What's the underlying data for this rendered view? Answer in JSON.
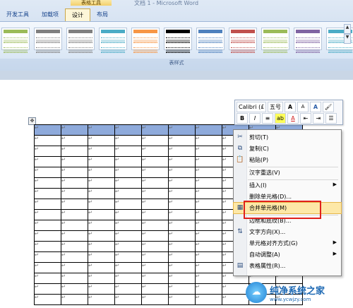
{
  "window": {
    "contextual_tab_group": "表格工具",
    "doc_title": "文档 1 - Microsoft Word"
  },
  "tabs": [
    {
      "label": "开发工具",
      "active": false
    },
    {
      "label": "加载项",
      "active": false
    },
    {
      "label": "设计",
      "active": true
    },
    {
      "label": "布局",
      "active": false
    }
  ],
  "ribbon": {
    "group_label": "表样式",
    "swatch_colors": [
      "#9bbb59",
      "#7f7f7f",
      "#7f7f7f",
      "#4bacc6",
      "#f79646",
      "#000000",
      "#4f81bd",
      "#c0504d",
      "#9bbb59",
      "#8064a2",
      "#4bacc6"
    ]
  },
  "mini_toolbar": {
    "font_name": "Calibri (£",
    "font_size": "五号",
    "grow_font": "A",
    "shrink_font": "A",
    "style_a": "A",
    "bold": "B",
    "italic": "I",
    "highlight": "ab",
    "font_color": "A"
  },
  "table": {
    "handle_icon": "move-icon",
    "columns": 10,
    "rows": 17,
    "cell_mark": "↵"
  },
  "context_menu": {
    "items": [
      {
        "label": "剪切(T)",
        "icon": "scissors-icon",
        "submenu": false
      },
      {
        "label": "复制(C)",
        "icon": "copy-icon",
        "submenu": false
      },
      {
        "label": "粘贴(P)",
        "icon": "paste-icon",
        "submenu": false
      },
      {
        "label": "汉字重选(V)",
        "icon": "",
        "submenu": false
      },
      {
        "label": "插入(I)",
        "icon": "",
        "submenu": true
      },
      {
        "label": "删除单元格(D)...",
        "icon": "",
        "submenu": false
      },
      {
        "label": "合并单元格(M)",
        "icon": "merge-cells-icon",
        "submenu": false,
        "highlighted": true
      },
      {
        "label": "边框和底纹(B)...",
        "icon": "",
        "submenu": false
      },
      {
        "label": "文字方向(X)...",
        "icon": "text-direction-icon",
        "submenu": false
      },
      {
        "label": "单元格对齐方式(G)",
        "icon": "",
        "submenu": true
      },
      {
        "label": "自动调整(A)",
        "icon": "",
        "submenu": true
      },
      {
        "label": "表格属性(R)...",
        "icon": "table-properties-icon",
        "submenu": false
      }
    ]
  },
  "watermark": {
    "title": "纯净系统之家",
    "url": "www.ycwjzy.com"
  }
}
